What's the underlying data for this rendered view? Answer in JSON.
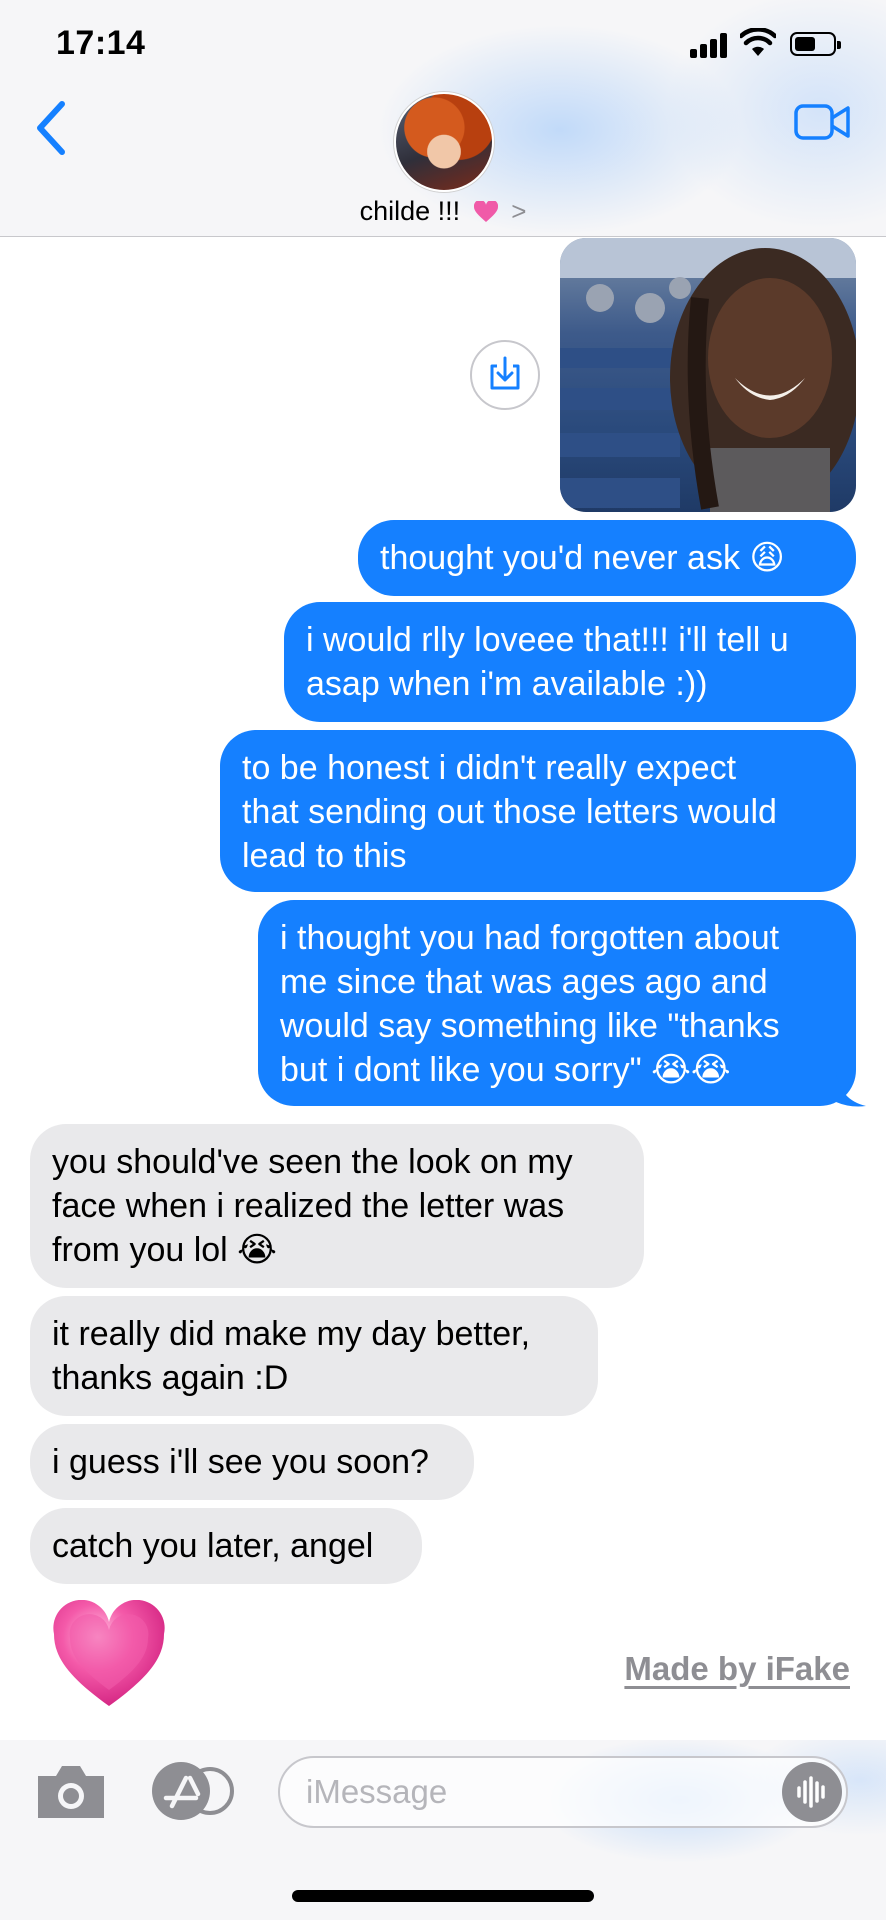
{
  "status_bar": {
    "time": "17:14"
  },
  "header": {
    "contact_name": "childe !!!",
    "contact_emoji": "pink-heart-emoji",
    "chevron": ">"
  },
  "icons": {
    "back": "chevron-left-icon",
    "video": "video-camera-icon",
    "save": "download-icon",
    "camera": "camera-icon",
    "apps": "app-store-icon",
    "audio": "waveform-icon"
  },
  "photo": {
    "description_shown": false
  },
  "messages": [
    {
      "dir": "sent",
      "text": "thought you'd never ask 😩"
    },
    {
      "dir": "sent",
      "text": "i would rlly loveee that!!! i'll tell u\nasap when i'm available :))"
    },
    {
      "dir": "sent",
      "text": "to be honest i didn't really expect\nthat sending out those letters would\nlead to this"
    },
    {
      "dir": "sent",
      "text": "i thought you had forgotten about\nme since that was ages ago and\nwould say something like \"thanks\nbut i dont like you sorry\" 😭😭"
    },
    {
      "dir": "recv",
      "text": "you should've seen the look on my\nface when i realized the letter was\nfrom you lol 😭"
    },
    {
      "dir": "recv",
      "text": "it really did make my day better,\nthanks again :D"
    },
    {
      "dir": "recv",
      "text": "i guess i'll see you soon?"
    },
    {
      "dir": "recv",
      "text": "catch you later, angel"
    }
  ],
  "big_emoji": "pink-heart-emoji",
  "watermark": "Made by iFake",
  "input": {
    "placeholder": "iMessage",
    "value": ""
  },
  "colors": {
    "sent": "#1580ff",
    "received": "#e9e9eb",
    "accent": "#1580ff"
  }
}
